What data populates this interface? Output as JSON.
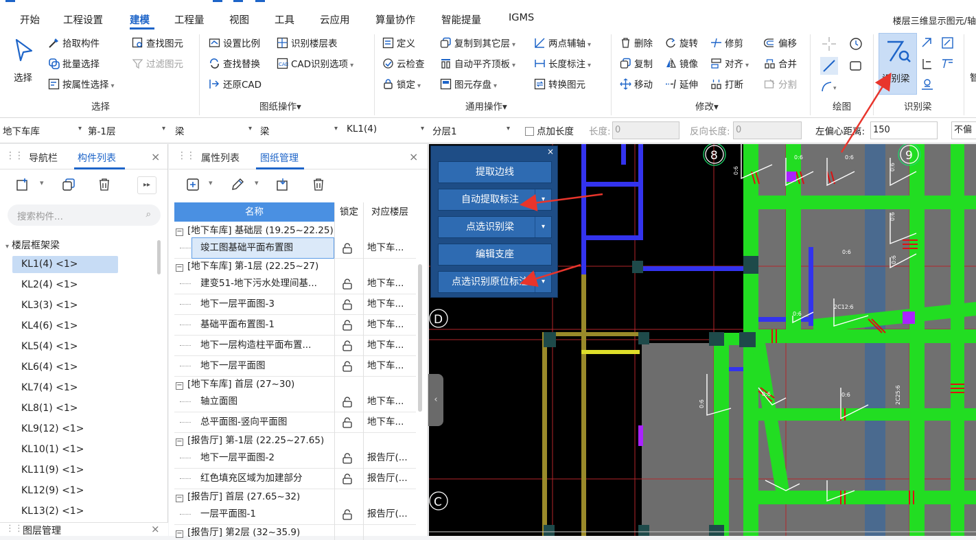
{
  "menu": {
    "items": [
      "开始",
      "工程设置",
      "建模",
      "工程量",
      "视图",
      "工具",
      "云应用",
      "算量协作",
      "智能提量",
      "IGMS"
    ],
    "active": "建模",
    "right_text": "楼层三维显示图元/轴"
  },
  "ribbon": {
    "select_big": "选择",
    "pick_component": "拾取构件",
    "batch_select": "批量选择",
    "select_by_attr": "按属性选择",
    "find_element": "查找图元",
    "filter_element": "过滤图元",
    "group_select": "选择",
    "set_scale": "设置比例",
    "identify_floor_table": "识别楼层表",
    "find_replace": "查找替换",
    "cad_options": "CAD识别选项",
    "restore_cad": "还原CAD",
    "group_drawing": "图纸操作",
    "define": "定义",
    "copy_to_floor": "复制到其它层",
    "two_point_axis": "两点辅轴",
    "cloud_check": "云检查",
    "auto_flush_top": "自动平齐顶板",
    "length_dim": "长度标注",
    "lock": "锁定",
    "element_store": "图元存盘",
    "convert_element": "转换图元",
    "group_general": "通用操作",
    "delete": "删除",
    "rotate": "旋转",
    "trim": "修剪",
    "offset": "偏移",
    "copy": "复制",
    "mirror": "镜像",
    "align": "对齐",
    "merge": "合并",
    "move": "移动",
    "extend": "延伸",
    "break": "打断",
    "split": "分割",
    "group_modify": "修改",
    "group_draw": "绘图",
    "identify_beam": "识别梁",
    "group_identify_beam": "识别梁",
    "cut_label": "智"
  },
  "filterbar": {
    "floor_group": "地下车库",
    "floor": "第-1层",
    "type1": "梁",
    "type2": "梁",
    "component": "KL1(4)",
    "layer": "分层1",
    "add_length_label": "点加长度",
    "length_label": "长度:",
    "length_value": "0",
    "reverse_length_label": "反向长度:",
    "reverse_length_value": "0",
    "left_offset_label": "左偏心距离:",
    "left_offset_value": "150",
    "right_cut": "不偏"
  },
  "left_panel": {
    "tabs": [
      "导航栏",
      "构件列表"
    ],
    "active_tab": "构件列表",
    "search_placeholder": "搜索构件...",
    "group": "楼层框架梁",
    "components": [
      "KL1(4) <1>",
      "KL2(4) <1>",
      "KL3(3) <1>",
      "KL4(6) <1>",
      "KL5(4) <1>",
      "KL6(4) <1>",
      "KL7(4) <1>",
      "KL8(1) <1>",
      "KL9(12) <1>",
      "KL10(1) <1>",
      "KL11(9) <1>",
      "KL12(9) <1>",
      "KL13(2) <1>"
    ],
    "bottom_tab": "图层管理"
  },
  "mid_panel": {
    "tabs": [
      "属性列表",
      "图纸管理"
    ],
    "active_tab": "图纸管理",
    "columns": [
      "名称",
      "锁定",
      "对应楼层"
    ],
    "rows": [
      {
        "type": "group",
        "text": "[地下车库] 基础层 (19.25~22.25)"
      },
      {
        "type": "item",
        "name": "竣工图基础平面布置图",
        "floor": "地下车..."
      },
      {
        "type": "group",
        "text": "[地下车库] 第-1层 (22.25~27)"
      },
      {
        "type": "item",
        "name": "建变51-地下污水处理间基...",
        "floor": "地下车..."
      },
      {
        "type": "item",
        "name": "地下一层平面图-3",
        "floor": "地下车..."
      },
      {
        "type": "item",
        "name": "基础平面布置图-1",
        "floor": "地下车..."
      },
      {
        "type": "item",
        "name": "地下一层构造柱平面布置...",
        "floor": "地下车..."
      },
      {
        "type": "item",
        "name": "地下一层平面图",
        "floor": "地下车..."
      },
      {
        "type": "group",
        "text": "[地下车库] 首层 (27~30)"
      },
      {
        "type": "item",
        "name": "轴立面图",
        "floor": "地下车..."
      },
      {
        "type": "item",
        "name": "总平面图-竖向平面图",
        "floor": "地下车..."
      },
      {
        "type": "group",
        "text": "[报告厅] 第-1层 (22.25~27.65)"
      },
      {
        "type": "item",
        "name": "地下一层平面图-2",
        "floor": "报告厅(..."
      },
      {
        "type": "item",
        "name": "红色填充区域为加建部分",
        "floor": "报告厅(..."
      },
      {
        "type": "group",
        "text": "[报告厅] 首层 (27.65~32)"
      },
      {
        "type": "item",
        "name": "一层平面图-1",
        "floor": "报告厅(..."
      },
      {
        "type": "group",
        "text": "[报告厅] 第2层 (32~35.9)"
      }
    ]
  },
  "float_panel": {
    "buttons": [
      "提取边线",
      "自动提取标注",
      "点选识别梁",
      "编辑支座",
      "点选识别原位标注"
    ]
  },
  "canvas": {
    "axis_labels": [
      "8",
      "9",
      "D",
      "C"
    ],
    "beam_labels": [
      "0:6",
      "0:6",
      "0:6",
      "0:6",
      "0:6",
      "0:6",
      "2C12:6",
      "0:6",
      "0:6",
      "0:6",
      "2C25:6",
      "0:6",
      "0:6"
    ]
  },
  "colors": {
    "accent": "#1d64c8",
    "table_header": "#4a90e2",
    "float_panel_bg": "#1e4d86",
    "float_button": "#2e6bb2",
    "beam_green": "#22dd22",
    "slab_gray": "#707070",
    "arrow_red": "#e8352c"
  }
}
